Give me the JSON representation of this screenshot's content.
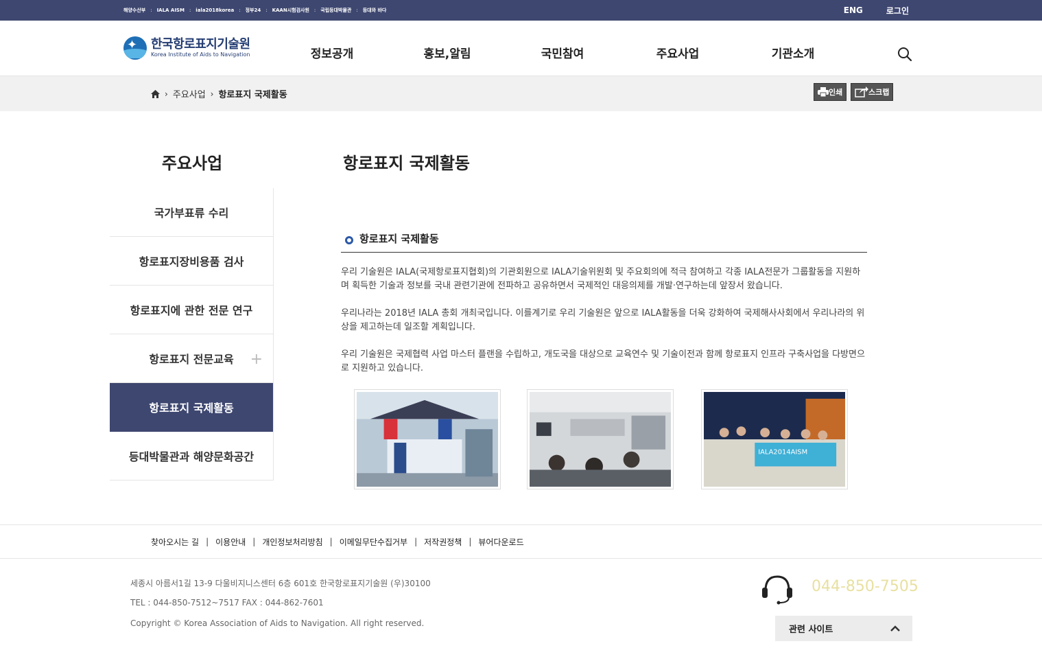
{
  "top_bar": {
    "links": [
      "해양수산부",
      "IALA AISM",
      "iala2018korea",
      "정부24",
      "KAAN시험검사원",
      "국립등대박물관",
      "등대와 바다"
    ],
    "lang_label": "ENG",
    "login_label": "로그인"
  },
  "header": {
    "logo_kr": "한국항로표지기술원",
    "logo_en": "Korea Institute of Aids to Navigation",
    "gnb": [
      "정보공개",
      "홍보,알림",
      "국민참여",
      "주요사업",
      "기관소개"
    ]
  },
  "breadcrumb": {
    "items": [
      "주요사업",
      "항로표지 국제활동"
    ],
    "print_label": "인쇄",
    "scrap_label": "스크랩"
  },
  "lnb": {
    "title": "주요사업",
    "items": [
      {
        "label": "국가부표류 수리"
      },
      {
        "label": "항로표지장비용품 검사"
      },
      {
        "label": "항로표지에 관한 전문 연구"
      },
      {
        "label": "항로표지 전문교육"
      },
      {
        "label": "항로표지 국제활동"
      },
      {
        "label": "등대박물관과 해양문화공간"
      }
    ]
  },
  "content": {
    "title": "항로표지 국제활동",
    "sub_heading": "항로표지 국제활동",
    "paragraphs": [
      "우리 기술원은 IALA(국제항로표지협회)의 기관회원으로 IALA기술위원회 및 주요회의에 적극 참여하고 각종 IALA전문가 그룹활동을 지원하며 획득한 기술과 정보를 국내 관련기관에 전파하고 공유하면서 국제적인 대응의제를 개발·연구하는데 앞장서 왔습니다.",
      "우리나라는 2018년 IALA 총회 개최국입니다. 이를계기로 우리 기술원은 앞으로 IALA활동을 더욱 강화하여 국제해사사회에서 우리나라의 위상을 제고하는데 일조할 계획입니다.",
      "우리 기술원은 국제협력 사업 마스터 플랜을 수립하고, 개도국을 대상으로 교육연수 및 기술이전과 함께 항로표지 인프라 구축사업을 다방면으로 지원하고 있습니다."
    ],
    "photo3_banner": "IALA2014AISM"
  },
  "footer": {
    "links": [
      "찾아오시는 길",
      "이용안내",
      "개인정보처리방침",
      "이메일무단수집거부",
      "저작권정책",
      "뷰어다운로드"
    ],
    "address": "세종시 아름서1길 13-9 다울비지니스센터 6층 601호 한국항로표지기술원 (우)30100",
    "tel_fax": "TEL : 044-850-7512~7517 FAX : 044-862-7601",
    "copyright": "Copyright © Korea Association of Aids to Navigation. All right reserved.",
    "phone": "044-850-7505",
    "related_label": "관련 사이트"
  },
  "colors": {
    "brand_navy": "#3e4770",
    "bullet_blue": "#2b59a8",
    "phone_yellow": "#e8e0a0"
  },
  "icons": [
    "home-icon",
    "search-icon",
    "print-icon",
    "scrap-icon",
    "headset-icon",
    "chevron-up-icon",
    "plus-icon"
  ]
}
